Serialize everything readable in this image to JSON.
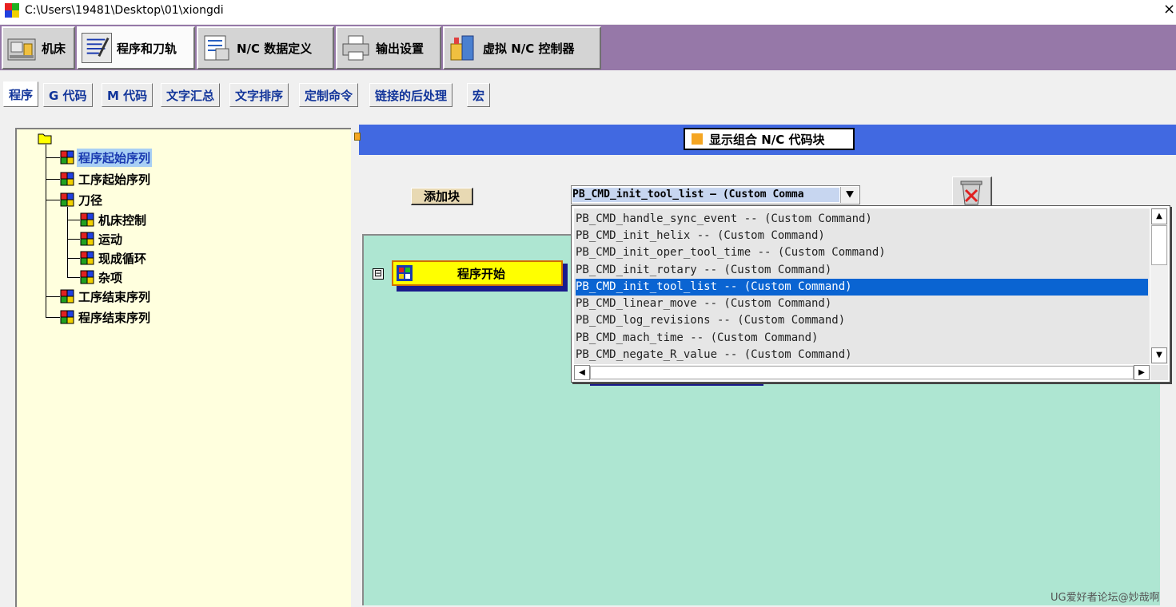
{
  "window": {
    "title": "C:\\Users\\19481\\Desktop\\01\\xiongdi",
    "close_glyph": "×"
  },
  "main_tabs": [
    {
      "label": "机床",
      "icon": "machine-icon"
    },
    {
      "label": "程序和刀轨",
      "icon": "program-toolpath-icon",
      "active": true
    },
    {
      "label": "N/C 数据定义",
      "icon": "nc-data-icon"
    },
    {
      "label": "输出设置",
      "icon": "printer-icon"
    },
    {
      "label": "虚拟 N/C 控制器",
      "icon": "virtual-controller-icon"
    }
  ],
  "sub_tabs": [
    {
      "label": "程序",
      "active": true
    },
    {
      "label": "G 代码"
    },
    {
      "label": "M 代码"
    },
    {
      "label": "文字汇总"
    },
    {
      "label": "文字排序"
    },
    {
      "label": "定制命令"
    },
    {
      "label": "链接的后处理"
    },
    {
      "label": "宏"
    }
  ],
  "tree": {
    "items": [
      {
        "label": "程序起始序列",
        "selected": true
      },
      {
        "label": "工序起始序列"
      },
      {
        "label": "刀径"
      },
      {
        "label": "机床控制"
      },
      {
        "label": "运动"
      },
      {
        "label": "现成循环"
      },
      {
        "label": "杂项"
      },
      {
        "label": "工序结束序列"
      },
      {
        "label": "程序结束序列"
      }
    ]
  },
  "right_panel": {
    "toggle_label": "显示组合 N/C 代码块",
    "add_block_label": "添加块",
    "combo_value": "PB_CMD_init_tool_list — (Custom Comma",
    "combo_arrow": "⯆",
    "collapse_glyph": "⊟",
    "program_start_block": "程序开始"
  },
  "dropdown": {
    "items": [
      "PB_CMD_handle_sync_event -- (Custom Command)",
      "PB_CMD_init_helix -- (Custom Command)",
      "PB_CMD_init_oper_tool_time -- (Custom Command)",
      "PB_CMD_init_rotary -- (Custom Command)",
      "PB_CMD_init_tool_list -- (Custom Command)",
      "PB_CMD_linear_move -- (Custom Command)",
      "PB_CMD_log_revisions -- (Custom Command)",
      "PB_CMD_mach_time -- (Custom Command)",
      "PB_CMD_negate_R_value -- (Custom Command)"
    ],
    "selected_index": 4,
    "scroll_up": "▲",
    "scroll_down": "▼",
    "scroll_left": "◀",
    "scroll_right": "▶"
  },
  "watermark": "UG爱好者论坛@妙哉啊",
  "colors": {
    "tab_band": "#9678a8",
    "header_blue": "#4169e1",
    "tree_bg": "#ffffde",
    "canvas_bg": "#aee6d2",
    "block_yellow": "#ffff00",
    "selection_blue": "#0a64d2"
  }
}
